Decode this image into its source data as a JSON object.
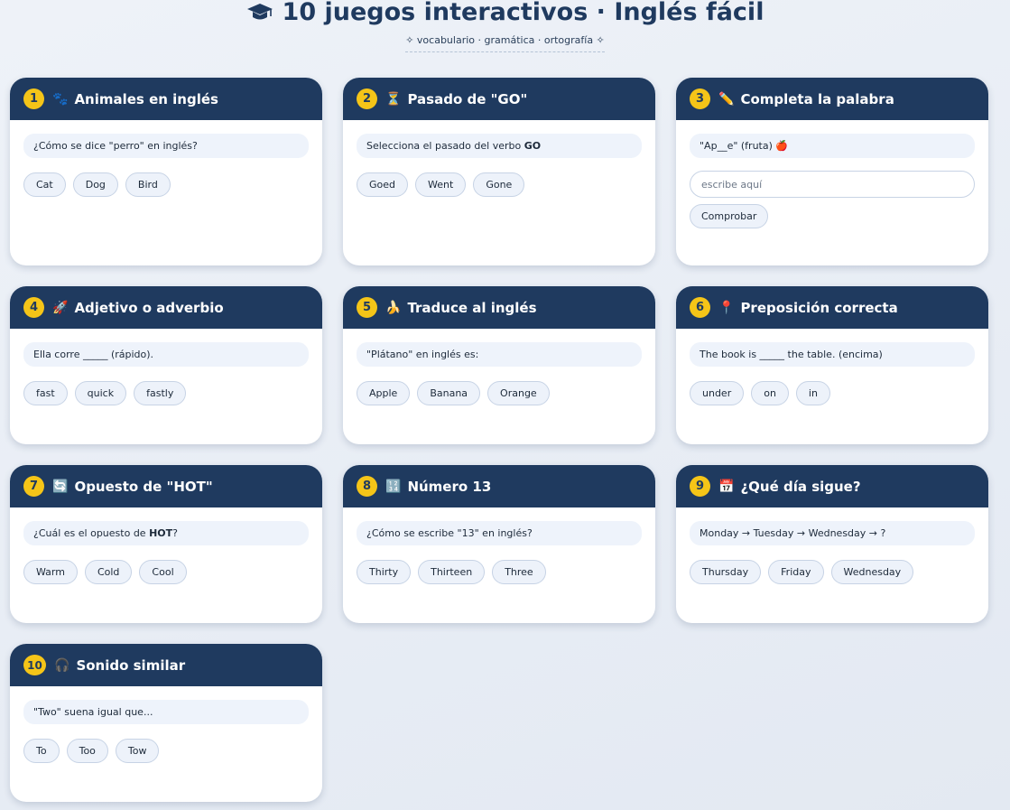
{
  "header": {
    "title": "10 juegos interactivos · Inglés fácil",
    "subtitle": "✧ vocabulario · gramática · ortografía ✧"
  },
  "colors": {
    "navy": "#1f3a5f",
    "accent": "#f5c518",
    "soft": "#eef3fb"
  },
  "cards": [
    {
      "num": "1",
      "emoji": "🐾",
      "title": "Animales en inglés",
      "question": "¿Cómo se dice \"perro\" en inglés?",
      "options": [
        "Cat",
        "Dog",
        "Bird"
      ]
    },
    {
      "num": "2",
      "emoji": "⏳",
      "title": "Pasado de \"GO\"",
      "question_pre": "Selecciona el pasado del verbo ",
      "question_bold": "GO",
      "options": [
        "Goed",
        "Went",
        "Gone"
      ]
    },
    {
      "num": "3",
      "emoji": "✏️",
      "title": "Completa la palabra",
      "question": "\"Ap__e\" (fruta) 🍎",
      "input_placeholder": "escribe aquí",
      "button_label": "Comprobar"
    },
    {
      "num": "4",
      "emoji": "🚀",
      "title": "Adjetivo o adverbio",
      "question": "Ella corre _____ (rápido).",
      "options": [
        "fast",
        "quick",
        "fastly"
      ]
    },
    {
      "num": "5",
      "emoji": "🍌",
      "title": "Traduce al inglés",
      "question": "\"Plátano\" en inglés es:",
      "options": [
        "Apple",
        "Banana",
        "Orange"
      ]
    },
    {
      "num": "6",
      "emoji": "📍",
      "title": "Preposición correcta",
      "question": "The book is _____ the table. (encima)",
      "options": [
        "under",
        "on",
        "in"
      ]
    },
    {
      "num": "7",
      "emoji": "🔄",
      "title": "Opuesto de \"HOT\"",
      "question_pre": "¿Cuál es el opuesto de ",
      "question_bold": "HOT",
      "question_post": "?",
      "options": [
        "Warm",
        "Cold",
        "Cool"
      ]
    },
    {
      "num": "8",
      "emoji": "🔢",
      "title": "Número 13",
      "question": "¿Cómo se escribe \"13\" en inglés?",
      "options": [
        "Thirty",
        "Thirteen",
        "Three"
      ]
    },
    {
      "num": "9",
      "emoji": "📅",
      "title": "¿Qué día sigue?",
      "question": "Monday → Tuesday → Wednesday → ?",
      "options": [
        "Thursday",
        "Friday",
        "Wednesday"
      ]
    },
    {
      "num": "10",
      "emoji": "🎧",
      "title": "Sonido similar",
      "question": "\"Two\" suena igual que...",
      "options": [
        "To",
        "Too",
        "Tow"
      ]
    }
  ]
}
